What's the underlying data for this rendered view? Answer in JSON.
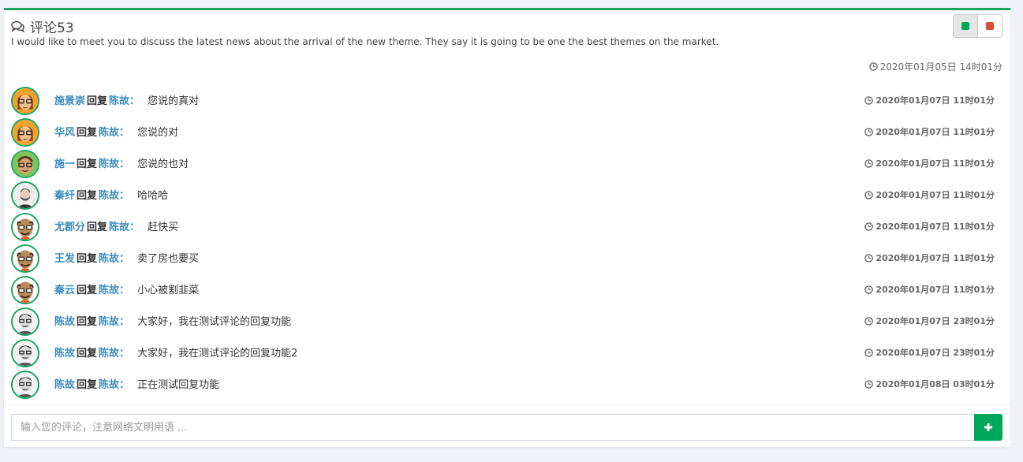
{
  "panel": {
    "title": "评论53",
    "description": "I would like to meet you to discuss the latest news about the arrival of the new theme. They say it is going to be one the best themes on the market.",
    "time": "2020年01月05日 14时01分",
    "tool_colors": {
      "green": "#00a65a",
      "red": "#dd4b39"
    },
    "accent": "#1aa363"
  },
  "comments": [
    {
      "user": "施景崇",
      "reply": "回复",
      "target": "陈故",
      "colon": "：",
      "text": "您说的真对",
      "time": "2020年01月07日 11时01分",
      "avatar": "avatar-orange-glasses"
    },
    {
      "user": "华风",
      "reply": "回复",
      "target": "陈故",
      "colon": "：",
      "text": "您说的对",
      "time": "2020年01月07日 11时01分",
      "avatar": "avatar-orange-glasses"
    },
    {
      "user": "施一",
      "reply": "回复",
      "target": "陈故",
      "colon": "：",
      "text": "您说的也对",
      "time": "2020年01月07日 11时01分",
      "avatar": "avatar-green-cartoon"
    },
    {
      "user": "秦纤",
      "reply": "回复",
      "target": "陈故",
      "colon": "：",
      "text": "哈哈哈",
      "time": "2020年01月07日 11时01分",
      "avatar": "avatar-bearded-man"
    },
    {
      "user": "尤郡分",
      "reply": "回复",
      "target": "陈故",
      "colon": "：",
      "text": "赶快买",
      "time": "2020年01月07日 11时01分",
      "avatar": "avatar-bald-cartoon"
    },
    {
      "user": "王发",
      "reply": "回复",
      "target": "陈故",
      "colon": "：",
      "text": "卖了房也要买",
      "time": "2020年01月07日 11时01分",
      "avatar": "avatar-bald-cartoon"
    },
    {
      "user": "秦云",
      "reply": "回复",
      "target": "陈故",
      "colon": "：",
      "text": "小心被割韭菜",
      "time": "2020年01月07日 11时01分",
      "avatar": "avatar-bald-cartoon"
    },
    {
      "user": "陈故",
      "reply": "回复",
      "target": "陈故",
      "colon": "：",
      "text": "大家好，我在测试评论的回复功能",
      "time": "2020年01月07日 23时01分",
      "avatar": "avatar-sketch-man"
    },
    {
      "user": "陈故",
      "reply": "回复",
      "target": "陈故",
      "colon": "：",
      "text": "大家好，我在测试评论的回复功能2",
      "time": "2020年01月07日 23时01分",
      "avatar": "avatar-sketch-man"
    },
    {
      "user": "陈故",
      "reply": "回复",
      "target": "陈故",
      "colon": "：",
      "text": "正在测试回复功能",
      "time": "2020年01月08日 03时01分",
      "avatar": "avatar-sketch-man"
    }
  ],
  "footer": {
    "placeholder": "输入您的评论，注意网络文明用语 ...",
    "add_icon": "plus-icon"
  }
}
